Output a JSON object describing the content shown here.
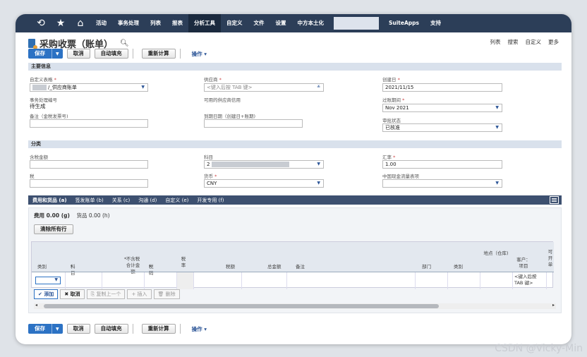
{
  "nav": {
    "items": [
      "活动",
      "事务处理",
      "列表",
      "报表",
      "分析工具",
      "自定义",
      "文件",
      "设置",
      "中方本土化",
      "SuiteApps",
      "支持"
    ],
    "active": "分析工具"
  },
  "page": {
    "title": "采购收票（账单）"
  },
  "toplinks": [
    "列表",
    "搜索",
    "自定义",
    "更多"
  ],
  "buttons": {
    "save": "保存",
    "cancel": "取消",
    "autofill": "自动填充",
    "recalc": "重新计算",
    "actions": "操作"
  },
  "sections": {
    "main": "主要信息",
    "class": "分类"
  },
  "main": {
    "form_label": "自定义表格",
    "form_value": "/_供应商账单",
    "vendor_label": "供应商",
    "vendor_placeholder": "<键入后按 TAB 键>",
    "date_label": "创建日",
    "date_value": "2021/11/15",
    "txn_label": "事务处理编号",
    "txn_value": "待生成",
    "credit_label": "可用的供应商信用",
    "period_label": "过账期间",
    "period_value": "Nov 2021",
    "memo_label": "备注（金税发票号)",
    "due_label": "到期日期（创建日+账期)",
    "approval_label": "审批状态",
    "approval_value": "已核准"
  },
  "classif": {
    "taxamt_label": "含税金额",
    "account_label": "科目",
    "account_value": "2",
    "rate_label": "汇率",
    "rate_value": "1.00",
    "tax_label": "税",
    "currency_label": "货币",
    "currency_value": "CNY",
    "cashflow_label": "中国现金流量表项"
  },
  "tabs": [
    "费用和货品 (a)",
    "签发账单 (b)",
    "关系 (c)",
    "沟通 (d)",
    "自定义 (e)",
    "开发专用 (f)"
  ],
  "subtabs": {
    "expense": "费用 0.00 (g)",
    "items": "货品 0.00 (h)"
  },
  "grid": {
    "clear_all": "清除所有行",
    "cols": [
      "类别",
      "科目",
      "不含税合计金额",
      "税码",
      "税率",
      "税额",
      "总金额",
      "备注",
      "部门",
      "类别",
      "地点（仓库)",
      "客户：项目",
      "可开单"
    ],
    "cust_placeholder": "<键入后按 TAB 键>",
    "btn_add": "添加",
    "btn_cancel": "取消",
    "btn_copy": "复制上一个",
    "btn_insert": "插入",
    "btn_delete": "删除"
  },
  "watermark": "CSDN @Vicky-Min"
}
